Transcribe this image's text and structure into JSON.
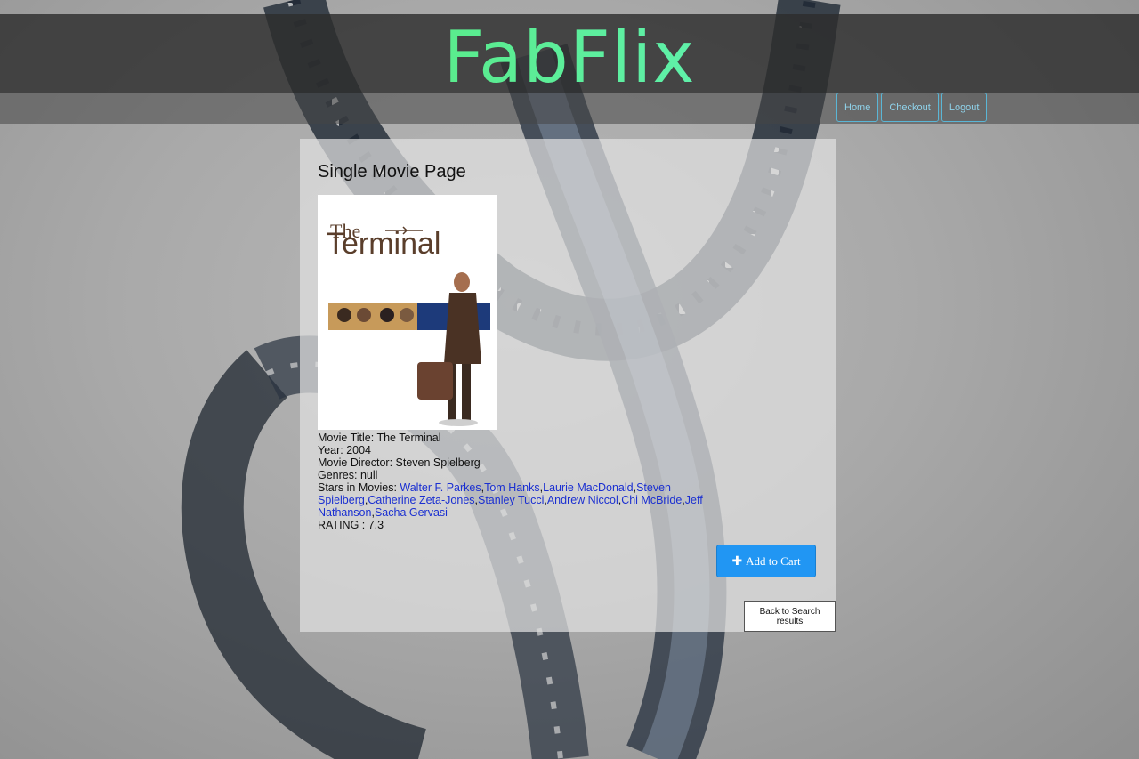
{
  "header": {
    "logo": "FabFlix",
    "nav": {
      "home": "Home",
      "checkout": "Checkout",
      "logout": "Logout"
    }
  },
  "page": {
    "title": "Single Movie Page",
    "poster": {
      "title_top": "The",
      "title_main": "Terminal"
    },
    "movie": {
      "title_label": "Movie Title: ",
      "title": "The Terminal",
      "year_label": "Year: ",
      "year": "2004",
      "director_label": "Movie Director: ",
      "director": "Steven Spielberg",
      "genres_label": "Genres: ",
      "genres": "null",
      "stars_label": "Stars in Movies: ",
      "stars": [
        "Walter F. Parkes",
        "Tom Hanks",
        "Laurie MacDonald",
        "Steven Spielberg",
        "Catherine Zeta-Jones",
        "Stanley Tucci",
        "Andrew Niccol",
        "Chi McBride",
        "Jeff Nathanson",
        "Sacha Gervasi"
      ],
      "rating_label": "RATING : ",
      "rating": "7.3"
    },
    "add_to_cart": "Add to Cart",
    "back": "Back to Search results"
  },
  "colors": {
    "accent": "#2196f3",
    "link": "#1a2fd1",
    "logo_gradient": [
      "#4fe35a",
      "#6ef6f0"
    ],
    "nav_border": "#5ab6d6"
  },
  "icons": {
    "add_to_cart": "plus-icon"
  }
}
